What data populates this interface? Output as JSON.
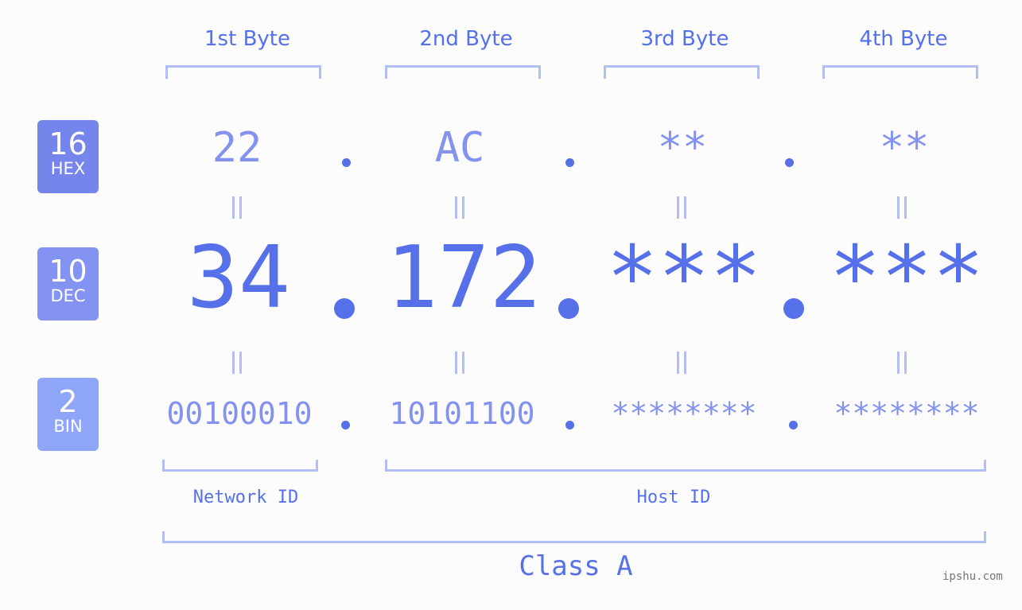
{
  "headers": [
    "1st Byte",
    "2nd Byte",
    "3rd Byte",
    "4th Byte"
  ],
  "badges": [
    {
      "num": "16",
      "label": "HEX",
      "color": "#7585ec"
    },
    {
      "num": "10",
      "label": "DEC",
      "color": "#8493f2"
    },
    {
      "num": "2",
      "label": "BIN",
      "color": "#8fa5f8"
    }
  ],
  "hex": [
    "22",
    "AC",
    "**",
    "**"
  ],
  "dec": [
    "34",
    "172",
    "***",
    "***"
  ],
  "bin": [
    "00100010",
    "10101100",
    "********",
    "********"
  ],
  "network_label": "Network ID",
  "host_label": "Host ID",
  "class_label": "Class A",
  "watermark": "ipshu.com"
}
